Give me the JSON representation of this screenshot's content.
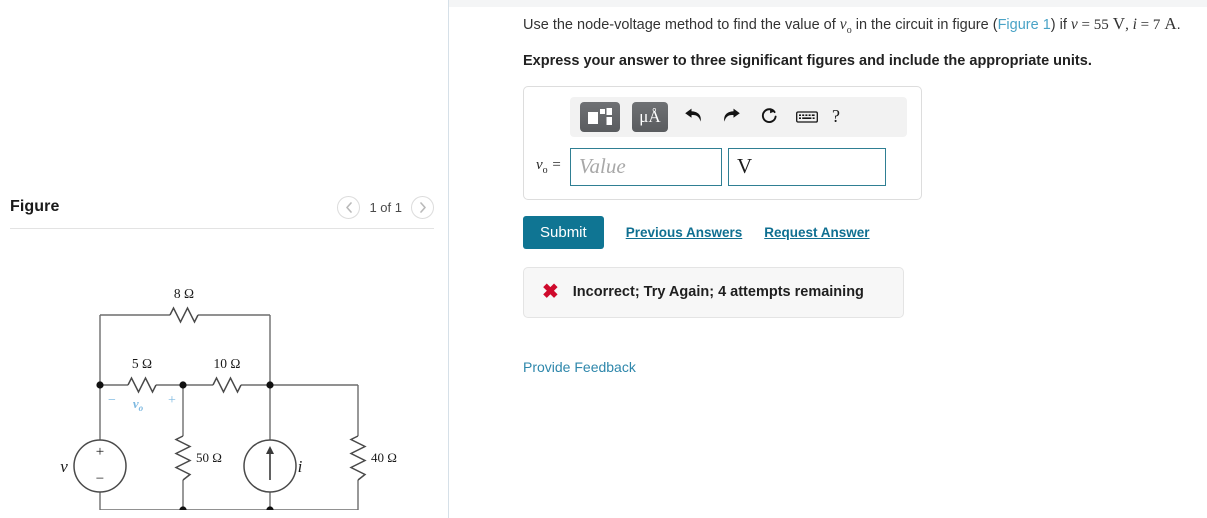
{
  "figure_panel": {
    "title": "Figure",
    "pager": {
      "prev_icon": "chevron-left-icon",
      "next_icon": "chevron-right-icon",
      "count_label": "1 of 1"
    },
    "circuit": {
      "caption": "",
      "source_voltage_label": "v",
      "source_polarity_top": "+",
      "source_polarity_bottom": "−",
      "current_source_label": "i",
      "vo_label": "v",
      "vo_subscript": "o",
      "vo_minus": "−",
      "vo_plus": "+",
      "vo_color": "#7cb8e0",
      "resistors": [
        {
          "name": "r8",
          "label": "8 Ω"
        },
        {
          "name": "r5",
          "label": "5 Ω"
        },
        {
          "name": "r10",
          "label": "10 Ω"
        },
        {
          "name": "r50",
          "label": "50 Ω"
        },
        {
          "name": "r40",
          "label": "40 Ω"
        }
      ]
    }
  },
  "problem": {
    "question": {
      "part1": "Use the node-voltage method to find the value of ",
      "var_vo": "v",
      "var_vo_sub": "o",
      "part2": " in the circuit in figure (",
      "figure_link": "Figure 1",
      "part3": ") if ",
      "var_v": "v",
      "eq1": " = ",
      "val_v": "55",
      "unit_v": "V",
      "comma": ", ",
      "var_i": "i",
      "eq2": " = ",
      "val_i": "7",
      "unit_i": "A",
      "period": "."
    },
    "instruction": "Express your answer to three significant figures and include the appropriate units.",
    "toolbar": {
      "template_icon": "math-template-icon",
      "units_icon": "micro-angstrom-units-icon",
      "units_label": "μÅ",
      "undo_icon": "undo-icon",
      "redo_icon": "redo-icon",
      "reset_icon": "reset-icon",
      "keyboard_icon": "keyboard-icon",
      "help_icon": "help-icon",
      "help_label": "?"
    },
    "answer": {
      "label_var": "v",
      "label_sub": "o",
      "label_eq": " =",
      "value": "",
      "value_placeholder": "Value",
      "unit_value": "V",
      "unit_placeholder": ""
    },
    "actions": {
      "submit_label": "Submit",
      "previous_answers_label": "Previous Answers",
      "request_answer_label": "Request Answer"
    },
    "status": {
      "icon": "red-x-icon",
      "icon_glyph": "✖",
      "message": "Incorrect; Try Again; 4 attempts remaining",
      "color": "#cf0a2c"
    },
    "feedback_link": "Provide Feedback"
  },
  "colors": {
    "accent_teal": "#0f7593",
    "link_blue": "#2e87ab",
    "figure_link": "#4aa3c6",
    "error_red": "#cf0a2c",
    "vo_blue": "#7cb8e0"
  }
}
